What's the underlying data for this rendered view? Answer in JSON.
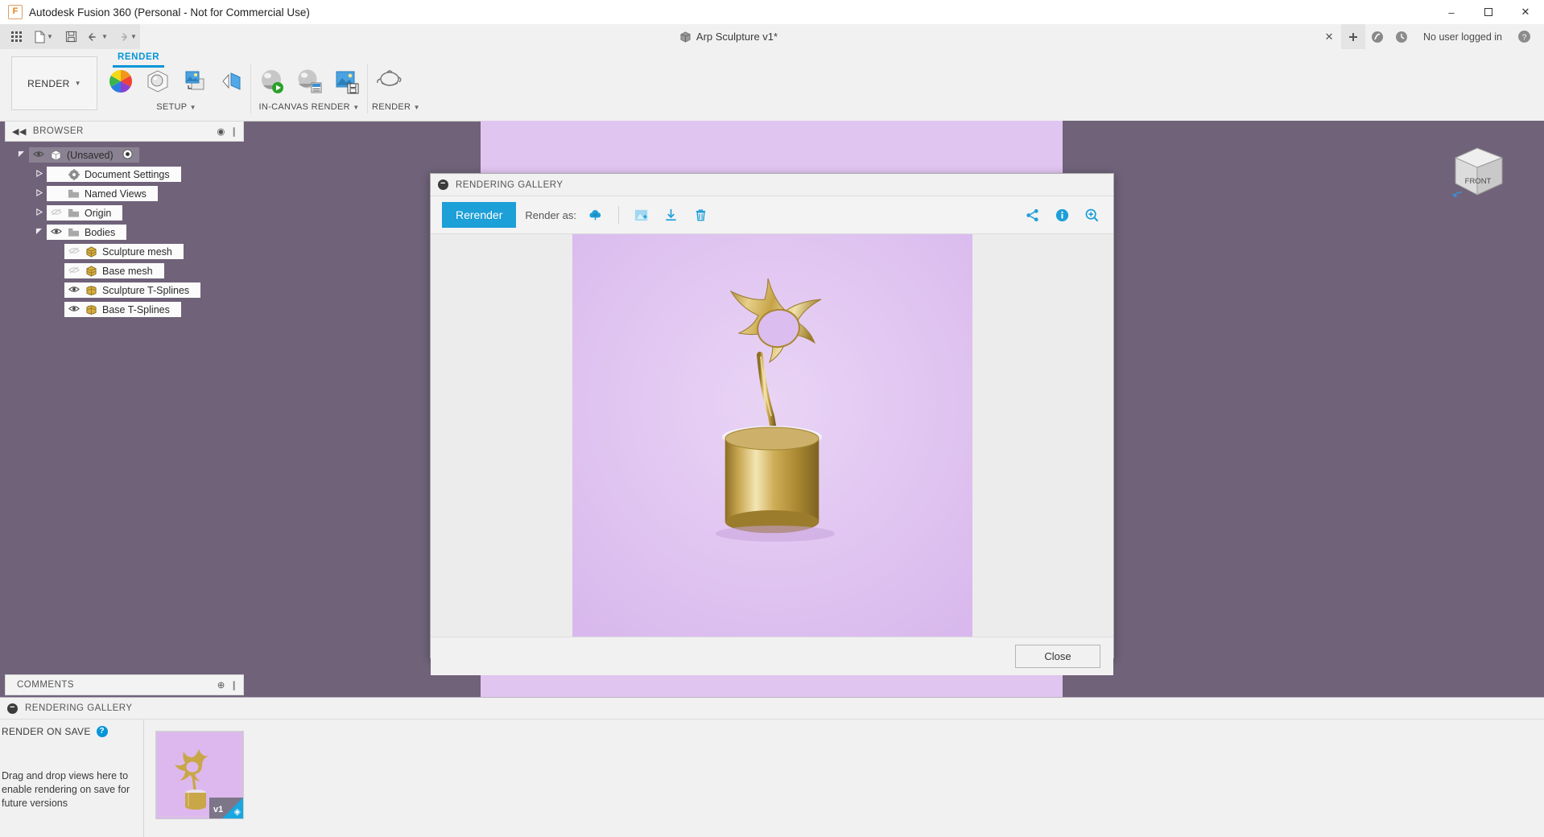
{
  "window": {
    "title": "Autodesk Fusion 360 (Personal - Not for Commercial Use)",
    "app_icon": "fusion-logo-icon",
    "minimize": "–",
    "maximize": "☐",
    "close": "✕"
  },
  "tabstrip": {
    "quick_access": [
      {
        "name": "app-grid",
        "glyph": "☷"
      },
      {
        "name": "new-document",
        "glyph": "὜b",
        "caret": true
      },
      {
        "name": "save",
        "glyph": "Ὃe"
      },
      {
        "name": "undo",
        "glyph": "↶",
        "caret": true
      },
      {
        "name": "redo",
        "glyph": "↷",
        "caret": true
      }
    ],
    "document_tab": "Arp Sculpture v1*",
    "close_tab": "✕",
    "new_tab": "+",
    "user_status": "No user logged in",
    "help": "?"
  },
  "ribbon": {
    "workspace": "RENDER",
    "active_tab": "RENDER",
    "panels": [
      {
        "label": "SETUP",
        "items": [
          {
            "name": "appearance-button",
            "icon": "color-wheel-icon"
          },
          {
            "name": "scene-settings-button",
            "icon": "scene-sphere-icon"
          },
          {
            "name": "texture-map-controls-button",
            "icon": "texture-map-icon"
          },
          {
            "name": "decal-button",
            "icon": "decal-icon"
          }
        ]
      },
      {
        "label": "IN-CANVAS RENDER",
        "items": [
          {
            "name": "in-canvas-render-button",
            "icon": "render-play-icon"
          },
          {
            "name": "in-canvas-render-settings-button",
            "icon": "render-settings-icon"
          },
          {
            "name": "capture-image-button",
            "icon": "capture-image-icon"
          }
        ]
      },
      {
        "label": "RENDER",
        "items": [
          {
            "name": "render-button",
            "icon": "teapot-icon"
          }
        ]
      }
    ]
  },
  "browser": {
    "title": "BROWSER",
    "collapse": "◀◀",
    "items": [
      {
        "label": "(Unsaved)",
        "indent": 0,
        "arrow": "down",
        "eye": "on",
        "icon": "document-icon",
        "selected": true,
        "has_radio": true
      },
      {
        "label": "Document Settings",
        "indent": 1,
        "arrow": "right",
        "eye": "none",
        "icon": "gear-icon"
      },
      {
        "label": "Named Views",
        "indent": 1,
        "arrow": "right",
        "eye": "none",
        "icon": "folder-icon"
      },
      {
        "label": "Origin",
        "indent": 1,
        "arrow": "right",
        "eye": "off",
        "icon": "folder-icon"
      },
      {
        "label": "Bodies",
        "indent": 1,
        "arrow": "down",
        "eye": "on",
        "icon": "folder-icon"
      },
      {
        "label": "Sculpture mesh",
        "indent": 2,
        "arrow": "none",
        "eye": "off",
        "icon": "mesh-body-icon"
      },
      {
        "label": "Base mesh",
        "indent": 2,
        "arrow": "none",
        "eye": "off",
        "icon": "mesh-body-icon"
      },
      {
        "label": "Sculpture T-Splines",
        "indent": 2,
        "arrow": "none",
        "eye": "on",
        "icon": "tspline-body-icon"
      },
      {
        "label": "Base T-Splines",
        "indent": 2,
        "arrow": "none",
        "eye": "on",
        "icon": "tspline-body-icon"
      }
    ]
  },
  "comments": {
    "title": "COMMENTS",
    "add": "⊕"
  },
  "navbar": {
    "items": [
      {
        "name": "orbit-tool",
        "glyph": "✥",
        "caret": true
      },
      {
        "name": "look-at-tool",
        "glyph": "Ὓc"
      },
      {
        "name": "pan-tool",
        "glyph": "✋"
      },
      {
        "name": "zoom-tool",
        "glyph": "ὐd"
      },
      {
        "name": "fit-tool",
        "glyph": "ὐe",
        "caret": true
      },
      {
        "name": "display-settings",
        "glyph": "Ὓ5",
        "caret": true
      },
      {
        "name": "grid-snaps",
        "glyph": "▒",
        "caret": true
      }
    ]
  },
  "viewcube": {
    "front_label": "FRONT"
  },
  "dialog": {
    "title": "RENDERING GALLERY",
    "rerender_label": "Rerender",
    "render_as_label": "Render as:",
    "tools": [
      {
        "name": "render-as-cloud-icon",
        "glyph": "cloud"
      },
      {
        "name": "image-adjust-icon",
        "glyph": "image-plus"
      },
      {
        "name": "download-icon",
        "glyph": "download"
      },
      {
        "name": "delete-icon",
        "glyph": "trash"
      }
    ],
    "right_tools": [
      {
        "name": "share-icon",
        "glyph": "share"
      },
      {
        "name": "info-icon",
        "glyph": "info"
      },
      {
        "name": "zoom-in-icon",
        "glyph": "zoom-in"
      }
    ],
    "close_label": "Close"
  },
  "gallery_panel": {
    "title": "RENDERING GALLERY",
    "render_on_save_label": "RENDER ON SAVE",
    "help": "?",
    "drop_text": "Drag and drop views here to enable rendering on save for future versions",
    "thumbnails": [
      {
        "name": "render-thumbnail-v1",
        "version": "v1"
      }
    ]
  },
  "colors": {
    "accent": "#1d9fd8",
    "canvas_bg": "#6f6279",
    "render_bg": "#e0c5f0",
    "gold": "#c9a748",
    "ribbon_bg": "#f1f1f1"
  }
}
